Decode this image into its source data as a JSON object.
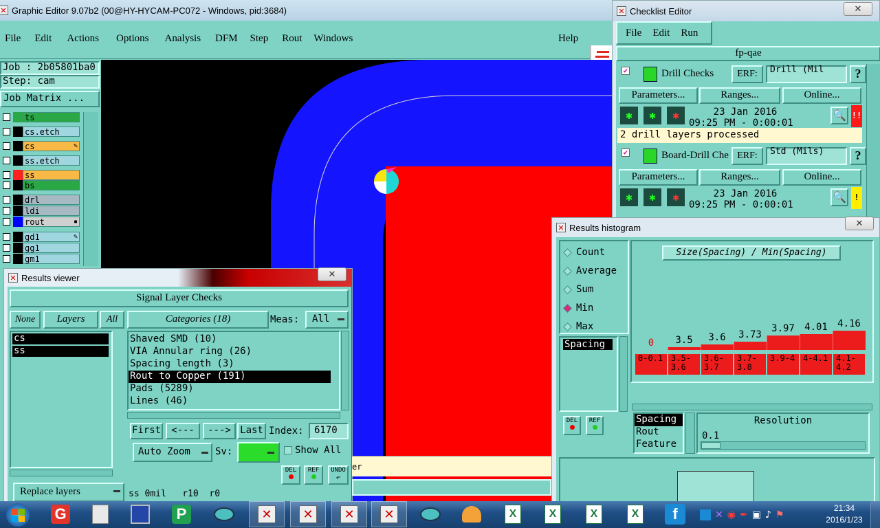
{
  "graphic_editor": {
    "title": "Graphic Editor 9.07b2 (00@HY-HYCAM-PC072 - Windows, pid:3684)",
    "menu": [
      "File",
      "Edit",
      "Actions",
      "Options",
      "Analysis",
      "DFM",
      "Step",
      "Rout",
      "Windows"
    ],
    "help": "Help",
    "job_label": "Job : 2b05801ba0",
    "step_label": "Step: cam",
    "job_matrix_button": "Job Matrix ...",
    "layers": [
      {
        "name": "ts",
        "color": "#2aa845",
        "swatch": "#2aa845"
      },
      {
        "name": "cs.etch",
        "color": "#9fd6e0",
        "swatch": "#000"
      },
      {
        "name": "cs",
        "color": "#f9b946",
        "swatch": "#000",
        "edit": true
      },
      {
        "name": "ss.etch",
        "color": "#9fd6e0",
        "swatch": "#000"
      },
      {
        "name": "ss",
        "color": "#f9b946",
        "swatch": "#ff2020"
      },
      {
        "name": "bs",
        "color": "#2aa845",
        "swatch": "#000"
      },
      {
        "name": "drl",
        "color": "#a7b9c2",
        "swatch": "#000"
      },
      {
        "name": "ldi",
        "color": "#a7b9c2",
        "swatch": "#000"
      },
      {
        "name": "rout",
        "color": "#d0d0d0",
        "swatch": "#0000ff",
        "box": true
      },
      {
        "name": "gd1",
        "color": "#9fd6e0",
        "swatch": "#000",
        "edit": true
      },
      {
        "name": "gg1",
        "color": "#9fd6e0",
        "swatch": "#000"
      },
      {
        "name": "gm1",
        "color": "#9fd6e0",
        "swatch": "#000"
      }
    ]
  },
  "checklist_editor": {
    "title": "Checklist Editor",
    "menu": [
      "File",
      "Edit",
      "Run"
    ],
    "checklist_name": "fp-qae",
    "checks": [
      {
        "name": "Drill Checks",
        "erf_label": "ERF:",
        "erf_value": "Drill (Mil",
        "help": "?",
        "params": "Parameters...",
        "ranges": "Ranges...",
        "online": "Online...",
        "date": "23 Jan 2016",
        "time": "09:25 PM - 0:00:01",
        "status": "!!",
        "status_color": "#ff1a1a",
        "message": "2 drill layers processed"
      },
      {
        "name": "Board-Drill Che",
        "erf_label": "ERF:",
        "erf_value": "Std (Mils)",
        "help": "?",
        "params": "Parameters...",
        "ranges": "Ranges...",
        "online": "Online...",
        "date": "23 Jan 2016",
        "time": "09:25 PM - 0:00:01",
        "status": "!",
        "status_color": "#ffee00",
        "message": ""
      }
    ]
  },
  "results_viewer": {
    "title": "Results viewer",
    "header": "Signal Layer Checks",
    "none_btn": "None",
    "layers_btn": "Layers",
    "all_btn": "All",
    "layers_list": [
      "cs",
      "ss"
    ],
    "categories_btn": "Categories (18)",
    "meas_label": "Meas:",
    "meas_value": "All",
    "categories": [
      "Shaved SMD (10)",
      "VIA Annular ring (26)",
      "Spacing length (3)",
      "Rout to Copper (191)",
      "Pads (5289)",
      "Lines (46)"
    ],
    "selected_category": 3,
    "first": "First",
    "prev": "<---",
    "next": "--->",
    "last": "Last",
    "index_label": "Index:",
    "index_value": "6170",
    "auto_zoom": "Auto Zoom",
    "sv_label": "Sv:",
    "show_all": "Show All",
    "replace_layers": "Replace layers",
    "del": "DEL",
    "ref": "REF",
    "undo": "UNDO",
    "status": "ss 0mil   r10  r0"
  },
  "histogram": {
    "title": "Results histogram",
    "modes": [
      "Count",
      "Average",
      "Sum",
      "Min",
      "Max"
    ],
    "selected_mode": "Min",
    "chart_title": "Size(Spacing) / Min(Spacing)",
    "list": [
      "Spacing"
    ],
    "bars": [
      {
        "range": "0-0.1",
        "value": "0",
        "height": 0
      },
      {
        "range": "3.5-3.6",
        "value": "3.5",
        "height": 3.5
      },
      {
        "range": "3.6-3.7",
        "value": "3.6",
        "height": 3.6
      },
      {
        "range": "3.7-3.8",
        "value": "3.73",
        "height": 3.73
      },
      {
        "range": "3.9-4",
        "value": "3.97",
        "height": 3.97
      },
      {
        "range": "4-4.1",
        "value": "4.01",
        "height": 4.01
      },
      {
        "range": "4.1-4.2",
        "value": "4.16",
        "height": 4.16
      }
    ],
    "type_list": [
      "Spacing",
      "Rout",
      "Feature"
    ],
    "resolution_label": "Resolution",
    "resolution_value": "0.1",
    "del": "DEL",
    "ref": "REF"
  },
  "partial_text": "er",
  "taskbar": {
    "time": "21:34",
    "date": "2016/1/23"
  }
}
